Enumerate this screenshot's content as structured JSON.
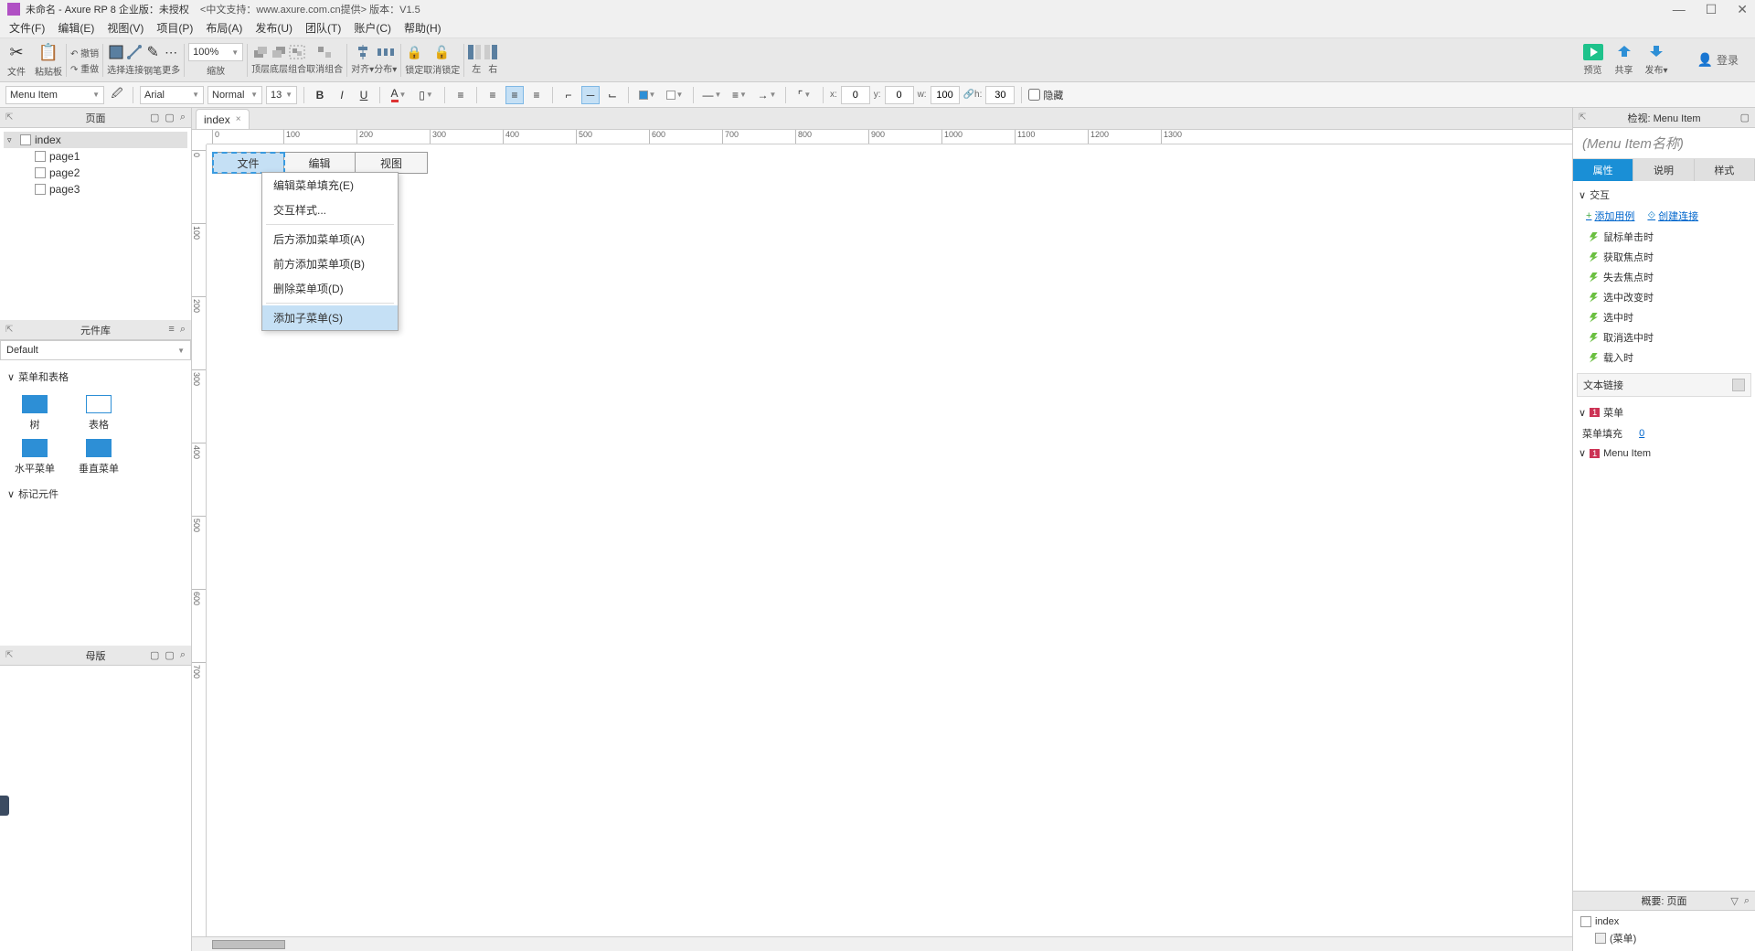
{
  "title": {
    "main": "未命名 - Axure RP 8 企业版：未授权",
    "extra": "<中文支持：www.axure.com.cn提供> 版本：V1.5"
  },
  "menubar": [
    "文件(F)",
    "编辑(E)",
    "视图(V)",
    "项目(P)",
    "布局(A)",
    "发布(U)",
    "团队(T)",
    "账户(C)",
    "帮助(H)"
  ],
  "ribbon": {
    "cut": "文件",
    "paste": "粘贴板",
    "select_mode": "选择",
    "connect": "连接",
    "pen": "钢笔",
    "more": "更多",
    "zoom_value": "100%",
    "zoom_label": "缩放",
    "top": "顶层",
    "bottom": "底层",
    "group": "组合",
    "ungroup": "取消组合",
    "align": "对齐",
    "distribute": "分布",
    "lock": "锁定",
    "show_hide": "取消锁定",
    "left": "左",
    "right": "右",
    "undo": "撤销",
    "redo": "重做",
    "preview": "预览",
    "share": "共享",
    "publish": "发布",
    "login": "登录"
  },
  "format": {
    "shape_select": "Menu Item",
    "font": "Arial",
    "weight": "Normal",
    "size": "13",
    "x": "0",
    "y": "0",
    "w": "100",
    "h": "30",
    "hidden": "隐藏"
  },
  "left": {
    "pages_title": "页面",
    "pages": [
      {
        "name": "index",
        "selected": true,
        "expandable": true
      },
      {
        "name": "page1"
      },
      {
        "name": "page2"
      },
      {
        "name": "page3"
      }
    ],
    "library_title": "元件库",
    "library_select": "Default",
    "cat_menus": "菜单和表格",
    "widgets_menus": [
      {
        "name": "树"
      },
      {
        "name": "表格"
      },
      {
        "name": "水平菜单"
      },
      {
        "name": "垂直菜单"
      }
    ],
    "cat_marker": "标记元件",
    "masters_title": "母版"
  },
  "tab": "index",
  "canvas_menu": [
    "文件",
    "编辑",
    "视图"
  ],
  "context_menu": [
    {
      "label": "编辑菜单填充(E)"
    },
    {
      "label": "交互样式..."
    },
    {
      "sep": true
    },
    {
      "label": "后方添加菜单项(A)"
    },
    {
      "label": "前方添加菜单项(B)"
    },
    {
      "label": "删除菜单项(D)"
    },
    {
      "sep": true
    },
    {
      "label": "添加子菜单(S)",
      "hover": true
    }
  ],
  "inspector": {
    "header": "检视: Menu Item",
    "name_placeholder": "(Menu Item名称)",
    "tabs": [
      "属性",
      "说明",
      "样式"
    ],
    "section_inter": "交互",
    "add_case": "添加用例",
    "create_link": "创建连接",
    "events": [
      "鼠标单击时",
      "获取焦点时",
      "失去焦点时",
      "选中改变时",
      "选中时",
      "取消选中时",
      "载入时"
    ],
    "text_link": "文本链接",
    "menu_section": "菜单",
    "menu_fill": "菜单填充",
    "menu_fill_val": "0",
    "menuitem_section": "Menu Item",
    "outline_title": "概要: 页面",
    "outline": [
      {
        "name": "index",
        "icon": "page"
      },
      {
        "name": "(菜单)",
        "icon": "menu",
        "child": true
      }
    ]
  },
  "ruler_ticks": [
    "0",
    "100",
    "200",
    "300",
    "400",
    "500",
    "600",
    "700",
    "800",
    "900",
    "1000",
    "1100",
    "1200",
    "1300"
  ],
  "vruler_ticks": [
    "0",
    "100",
    "200",
    "300",
    "400",
    "500",
    "600",
    "700"
  ]
}
